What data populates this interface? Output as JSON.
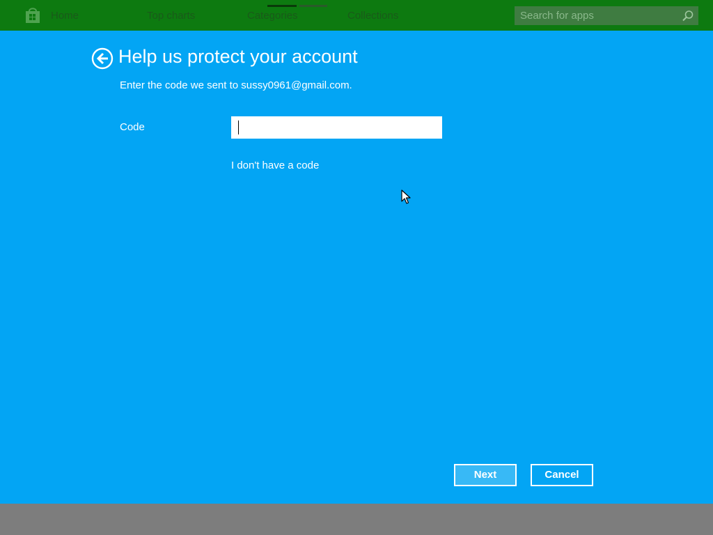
{
  "topbar": {
    "nav": {
      "home": "Home",
      "top_charts": "Top charts",
      "categories": "Categories",
      "collections": "Collections"
    },
    "search": {
      "placeholder": "Search for apps",
      "icon": "search-icon"
    },
    "logo_icon": "store-bag-icon"
  },
  "dialog": {
    "title": "Help us protect your account",
    "subtitle": "Enter the code we sent to sussy0961@gmail.com.",
    "code_label": "Code",
    "code_value": "",
    "no_code_link": "I don't have a code",
    "next_label": "Next",
    "cancel_label": "Cancel",
    "back_icon": "back-arrow-icon"
  },
  "colors": {
    "topbar": "#0d7a10",
    "dialog_background": "#03a5f4",
    "next_button": "#38b9f6",
    "bottom_bar": "#7d7d7d"
  }
}
